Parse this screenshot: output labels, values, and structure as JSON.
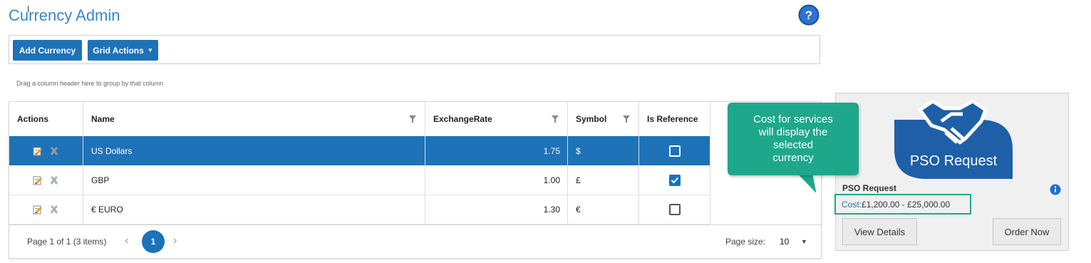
{
  "page": {
    "title": "Currency Admin"
  },
  "toolbar": {
    "add_label": "Add Currency",
    "grid_actions_label": "Grid Actions"
  },
  "grid": {
    "group_hint": "Drag a column header here to group by that column",
    "headers": {
      "actions": "Actions",
      "name": "Name",
      "rate": "ExchangeRate",
      "symbol": "Symbol",
      "is_reference": "Is Reference"
    },
    "rows": [
      {
        "name": "US Dollars",
        "rate": "1.75",
        "symbol": "$",
        "is_reference": false,
        "selected": true
      },
      {
        "name": "GBP",
        "rate": "1.00",
        "symbol": "£",
        "is_reference": true,
        "selected": false
      },
      {
        "name": "€ EURO",
        "rate": "1.30",
        "symbol": "€",
        "is_reference": false,
        "selected": false
      }
    ]
  },
  "pager": {
    "summary": "Page 1 of 1 (3 items)",
    "current_page": "1",
    "prev_icon": "‹",
    "next_icon": "›",
    "page_size_label": "Page size:",
    "page_size_value": "10",
    "page_size_caret": "▼"
  },
  "card": {
    "image_text": "PSO Request",
    "title": "PSO Request",
    "cost_label": "Cost:",
    "cost_value": "£1,200.00 - £25,000.00",
    "view_label": "View Details",
    "order_label": "Order Now"
  },
  "tooltip": {
    "lines": [
      "Cost for services",
      "will display the",
      "selected",
      "currency"
    ]
  },
  "icons": {
    "help": "question-circle-icon",
    "filter": "funnel-icon",
    "edit": "edit-icon",
    "delete": "delete-icon",
    "info": "info-icon",
    "handshake": "handshake-icon"
  },
  "colors": {
    "accent": "#1e72b8",
    "title": "#3a87c8",
    "callout": "#1fa78c"
  }
}
